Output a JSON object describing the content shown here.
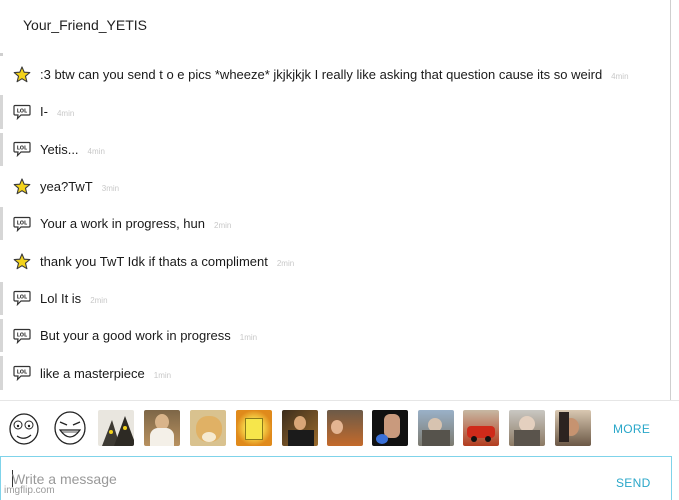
{
  "chat": {
    "title": "Your_Friend_YETIS"
  },
  "messages": [
    {
      "sender": "you",
      "icon": "star-icon",
      "text": ":3 btw can you send t o e pics *wheeze* jkjkjkjk I really like asking that question cause its so weird",
      "time": "4min"
    },
    {
      "sender": "friend",
      "icon": "lol-speech-bubble-icon",
      "text": "I-",
      "time": "4min"
    },
    {
      "sender": "friend",
      "icon": "lol-speech-bubble-icon",
      "text": "Yetis...",
      "time": "4min"
    },
    {
      "sender": "you",
      "icon": "star-icon",
      "text": "yea?TwT",
      "time": "3min"
    },
    {
      "sender": "friend",
      "icon": "lol-speech-bubble-icon",
      "text": "Your a work in progress, hun",
      "time": "2min"
    },
    {
      "sender": "you",
      "icon": "star-icon",
      "text": "thank you TwT Idk if thats a compliment",
      "time": "2min"
    },
    {
      "sender": "friend",
      "icon": "lol-speech-bubble-icon",
      "text": "Lol It is",
      "time": "2min"
    },
    {
      "sender": "friend",
      "icon": "lol-speech-bubble-icon",
      "text": "But your a good work in progress",
      "time": "1min"
    },
    {
      "sender": "friend",
      "icon": "lol-speech-bubble-icon",
      "text": "like a masterpiece",
      "time": "1min"
    }
  ],
  "meme_bar": {
    "memes": [
      {
        "name": "meme-rage-face-icon"
      },
      {
        "name": "meme-lol-face-icon"
      },
      {
        "name": "meme-cats-icon"
      },
      {
        "name": "meme-jesus-icon"
      },
      {
        "name": "meme-doge-icon"
      },
      {
        "name": "meme-spongebob-icon"
      },
      {
        "name": "meme-leo-toast-icon"
      },
      {
        "name": "meme-disaster-girl-icon"
      },
      {
        "name": "meme-hand-icon"
      },
      {
        "name": "meme-grandma-icon"
      },
      {
        "name": "meme-red-car-icon"
      },
      {
        "name": "meme-bernie-icon"
      },
      {
        "name": "meme-reaction-icon"
      }
    ],
    "more_label": "MORE"
  },
  "composer": {
    "placeholder": "Write a message",
    "send_label": "SEND"
  },
  "watermark": "imgflip.com",
  "colors": {
    "accent": "#2aa7c9",
    "star": "#f2d21b",
    "timestamp": "#c8c8c8",
    "composer_border": "#7fd3ea"
  }
}
